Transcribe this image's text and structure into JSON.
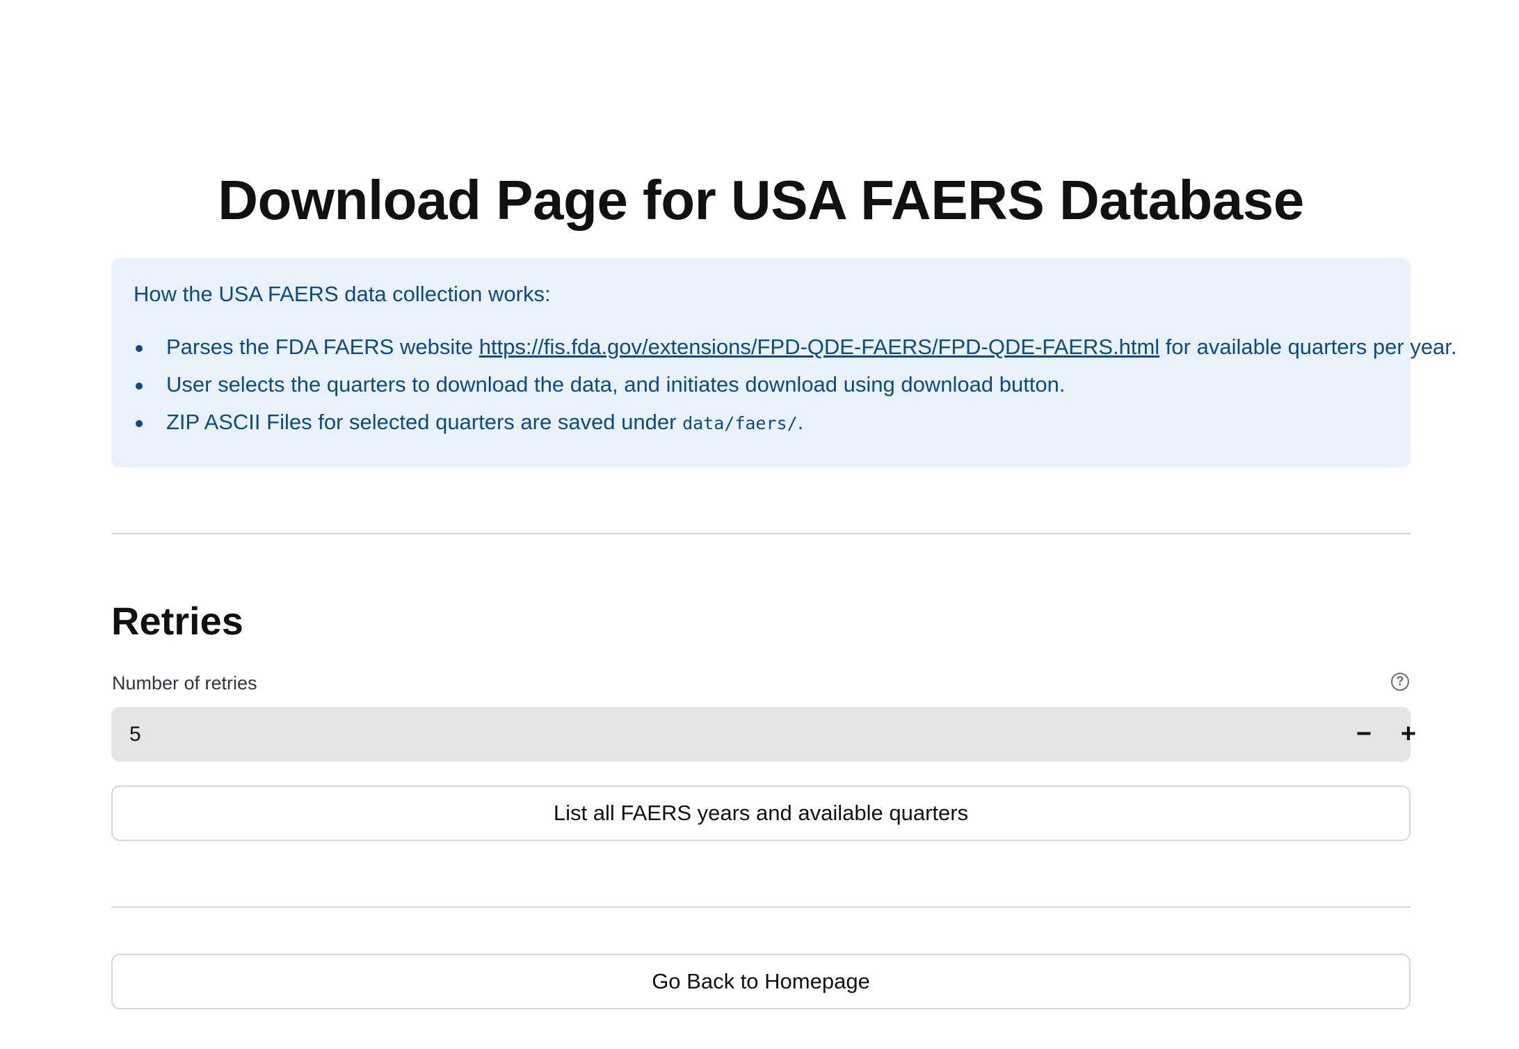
{
  "page": {
    "title": "Download Page for USA FAERS Database"
  },
  "info": {
    "heading": "How the USA FAERS data collection works:",
    "items": [
      {
        "before": "Parses the FDA FAERS website ",
        "link": "https://fis.fda.gov/extensions/FPD-QDE-FAERS/FPD-QDE-FAERS.html",
        "after": " for available quarters per year."
      },
      {
        "text": "User selects the quarters to download the data, and initiates download using download button."
      },
      {
        "before": "ZIP ASCII Files for selected quarters are saved under ",
        "code": "data/faers/",
        "after": "."
      }
    ]
  },
  "retries": {
    "section_title": "Retries",
    "field_label": "Number of retries",
    "value": "5",
    "minus_label": "−",
    "plus_label": "+",
    "help_glyph": "?"
  },
  "buttons": {
    "list_quarters": "List all FAERS years and available quarters",
    "go_back": "Go Back to Homepage"
  },
  "colors": {
    "info_background": "#e9f1fb",
    "info_text": "#0c4a85",
    "input_background": "#e6e5e3"
  }
}
